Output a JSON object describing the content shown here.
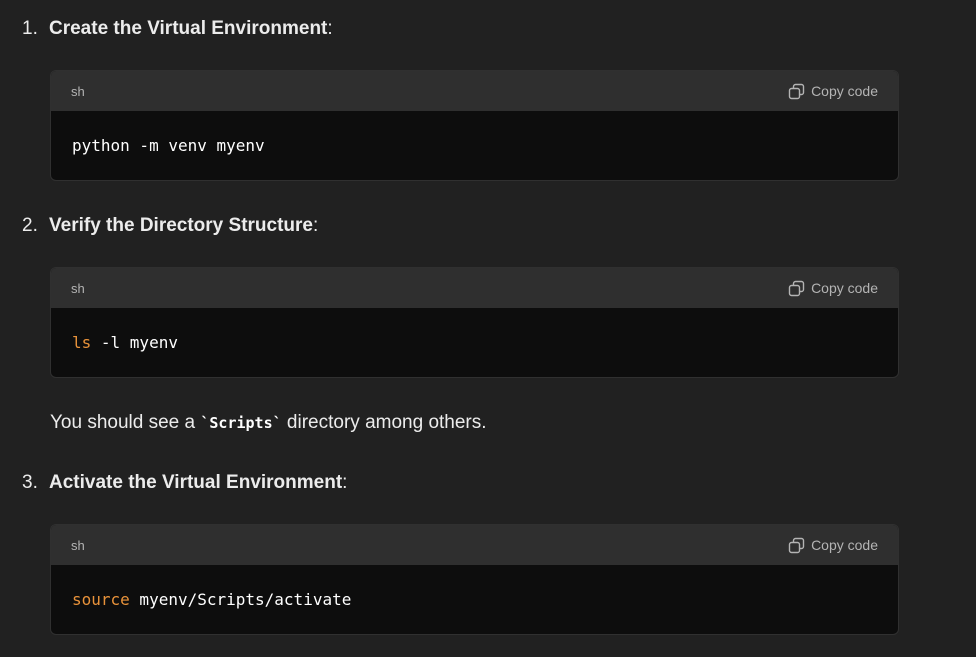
{
  "steps": [
    {
      "number": "1.",
      "title": "Create the Virtual Environment",
      "suffix": ":",
      "code": {
        "lang": "sh",
        "copy_label": "Copy code",
        "keyword": "",
        "text": "python -m venv myenv"
      }
    },
    {
      "number": "2.",
      "title": "Verify the Directory Structure",
      "suffix": ":",
      "code": {
        "lang": "sh",
        "copy_label": "Copy code",
        "keyword": "ls",
        "text": " -l myenv"
      }
    },
    {
      "number": "3.",
      "title": "Activate the Virtual Environment",
      "suffix": ":",
      "code": {
        "lang": "sh",
        "copy_label": "Copy code",
        "keyword": "source",
        "text": " myenv/Scripts/activate"
      }
    }
  ],
  "note": {
    "before": "You should see a ",
    "code": "`Scripts`",
    "after": " directory among others."
  },
  "colors": {
    "background": "#212121",
    "code_header": "#2f2f2f",
    "code_body": "#0d0d0d",
    "keyword": "#e8923a"
  },
  "icons": {
    "copy": "copy-icon"
  }
}
